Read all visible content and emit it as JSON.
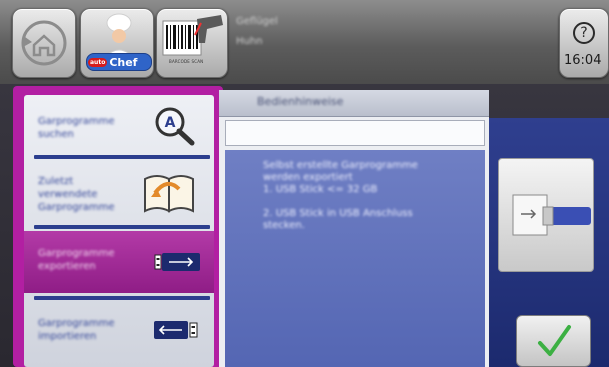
{
  "topbar": {
    "logo_text": "Chef",
    "logo_prefix": "auto",
    "scanner_caption": "BARCODE SCAN",
    "info_line1": "Geflügel",
    "info_line2": "Huhn",
    "help_symbol": "?",
    "time": "16:04"
  },
  "menu": {
    "items": [
      {
        "label": "Garprogramme\nsuchen"
      },
      {
        "label": "Zuletzt\nverwendete\nGarprogramme"
      },
      {
        "label": "Garprogramme\nexportieren"
      },
      {
        "label": "Garprogramme\nimportieren"
      }
    ],
    "selected_index": 2
  },
  "content": {
    "header_title": "Bedienhinweise",
    "field_value": "",
    "instructions": "Selbst erstellte Garprogramme\nwerden exportiert\n1. USB Stick <= 32 GB\n\n2. USB Stick in USB Anschluss\nstecken."
  },
  "colors": {
    "accent": "#b21fa2",
    "panel_blue": "#5466b3",
    "dark_blue": "#1c2a6e",
    "confirm_green": "#3cb043"
  }
}
